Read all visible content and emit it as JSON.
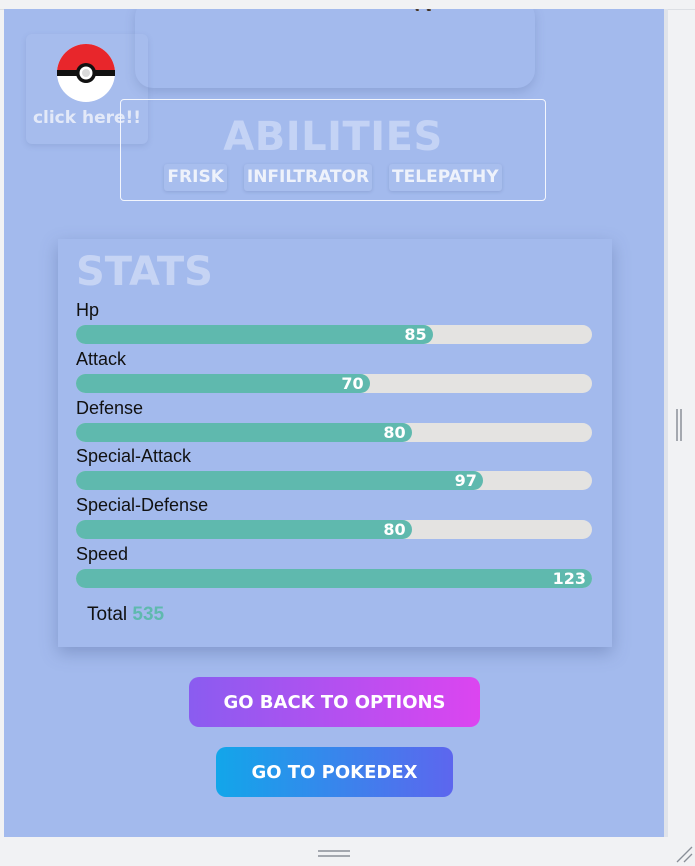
{
  "colors": {
    "page_background": "#a3baed",
    "stat_bar_fill": "#5fb9ae",
    "stat_bar_track": "#e4e3e1",
    "total_value": "#5fb9ae",
    "options_gradient": [
      "#8a5cf0",
      "#dc45f0"
    ],
    "pokedex_gradient": [
      "#12a6ea",
      "#5d66ee"
    ]
  },
  "pokeball_button": {
    "label": "click here!!",
    "icon": "pokeball-icon"
  },
  "abilities": {
    "title": "ABILITIES",
    "items": [
      "FRISK",
      "INFILTRATOR",
      "TELEPATHY"
    ]
  },
  "stats": {
    "title": "STATS",
    "items": [
      {
        "name": "Hp",
        "value": 85
      },
      {
        "name": "Attack",
        "value": 70
      },
      {
        "name": "Defense",
        "value": 80
      },
      {
        "name": "Special-Attack",
        "value": 97
      },
      {
        "name": "Special-Defense",
        "value": 80
      },
      {
        "name": "Speed",
        "value": 123
      }
    ],
    "max_value": 123,
    "total_label": "Total",
    "total_value": "535"
  },
  "buttons": {
    "go_back": "GO BACK TO OPTIONS",
    "go_pokedex": "GO TO POKEDEX"
  }
}
